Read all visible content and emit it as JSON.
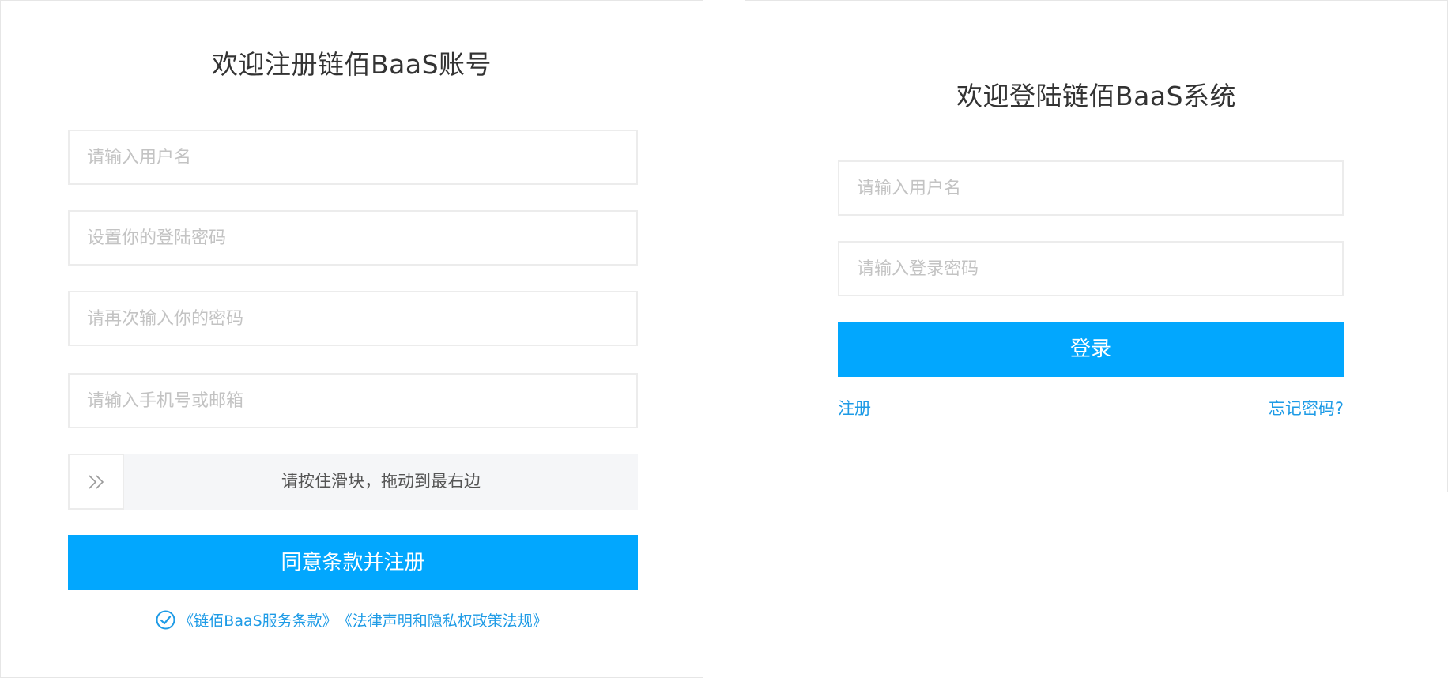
{
  "register": {
    "title": "欢迎注册链佰BaaS账号",
    "username_placeholder": "请输入用户名",
    "password_placeholder": "设置你的登陆密码",
    "confirm_placeholder": "请再次输入你的密码",
    "contact_placeholder": "请输入手机号或邮箱",
    "slider_text": "请按住滑块，拖动到最右边",
    "slider_icon": "double-chevron-right-icon",
    "submit_label": "同意条款并注册",
    "terms": {
      "checked": true,
      "check_icon": "check-circle-icon",
      "service_terms": "《链佰BaaS服务条款》",
      "privacy_terms": "《法律声明和隐私权政策法规》"
    }
  },
  "login": {
    "title": "欢迎登陆链佰BaaS系统",
    "username_placeholder": "请输入用户名",
    "password_placeholder": "请输入登录密码",
    "submit_label": "登录",
    "register_link": "注册",
    "forgot_link": "忘记密码?"
  },
  "colors": {
    "primary": "#02a7fe",
    "link": "#1e9be6",
    "border": "#ececec",
    "placeholder": "#c3c3c3",
    "slider_bg": "#f5f6f8"
  }
}
